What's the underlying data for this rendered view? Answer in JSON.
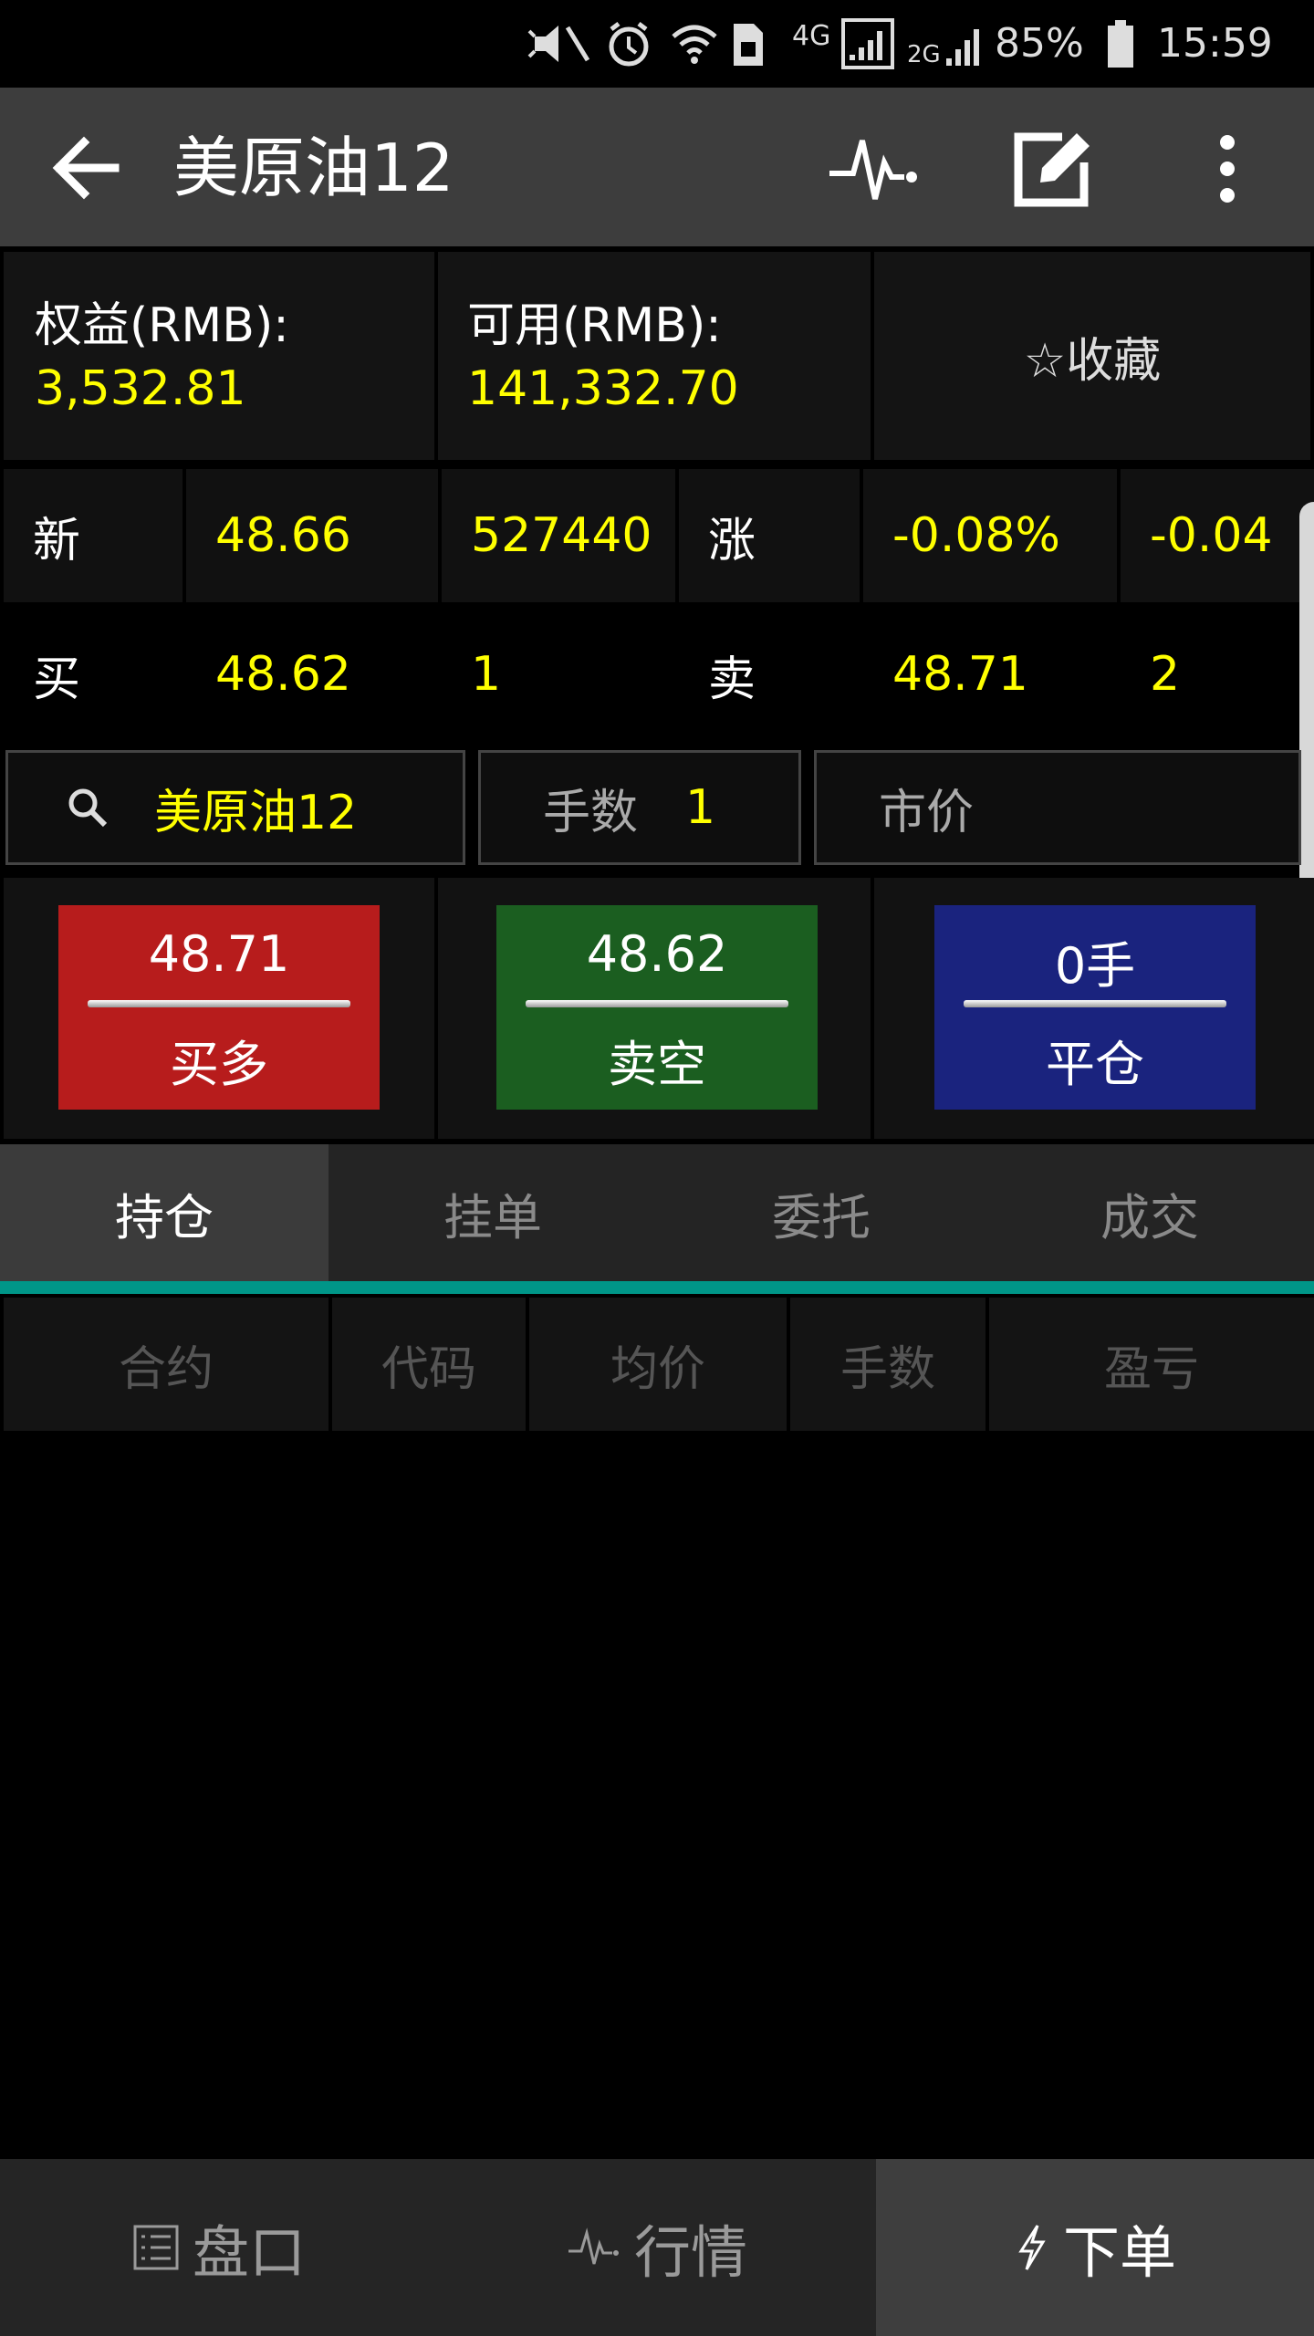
{
  "status_bar": {
    "net1": "4G",
    "net2": "2G",
    "battery": "85%",
    "time": "15:59"
  },
  "app_bar": {
    "title": "美原油12"
  },
  "account": {
    "equity_label": "权益(RMB):",
    "equity_value": "3,532.81",
    "available_label": "可用(RMB):",
    "available_value": "141,332.70",
    "favorite_label": "☆收藏"
  },
  "quote": {
    "row1": {
      "label": "新",
      "price": "48.66",
      "volume": "527440",
      "change_label": "涨",
      "change_pct": "-0.08%",
      "change_abs": "-0.04"
    },
    "row2": {
      "buy_label": "买",
      "bid": "48.62",
      "bid_qty": "1",
      "sell_label": "卖",
      "ask": "48.71",
      "ask_qty": "2"
    }
  },
  "order_input": {
    "symbol": "美原油12",
    "lots_label": "手数",
    "lots_value": "1",
    "price_type": "市价"
  },
  "trade_buttons": {
    "buy": {
      "price": "48.71",
      "label": "买多",
      "color": "#b71c1c"
    },
    "sell": {
      "price": "48.62",
      "label": "卖空",
      "color": "#1b5e20"
    },
    "close": {
      "qty": "0手",
      "label": "平仓",
      "color": "#1a237e"
    }
  },
  "tabs": [
    {
      "label": "持仓",
      "active": true
    },
    {
      "label": "挂单",
      "active": false
    },
    {
      "label": "委托",
      "active": false
    },
    {
      "label": "成交",
      "active": false
    }
  ],
  "table": {
    "columns": [
      "合约",
      "代码",
      "均价",
      "手数",
      "盈亏"
    ]
  },
  "bottom_nav": [
    {
      "label": "盘口",
      "icon": "list-icon",
      "active": false
    },
    {
      "label": "行情",
      "icon": "pulse-icon",
      "active": false
    },
    {
      "label": "下单",
      "icon": "bolt-icon",
      "active": true
    }
  ],
  "colors": {
    "accent": "#009688",
    "yellow": "#ffff00"
  }
}
